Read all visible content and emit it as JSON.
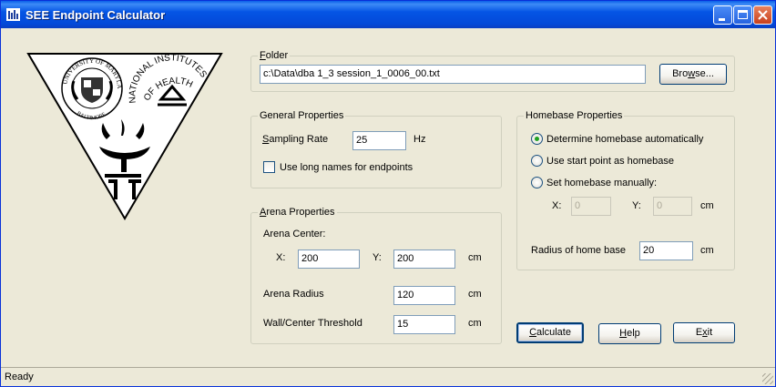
{
  "window": {
    "title": "SEE Endpoint Calculator"
  },
  "logo": {
    "university_text": "UNIVERSITY OF MARYLAND",
    "baltimore_text": "BALTIMORE",
    "nih_text": "NATIONAL INSTITUTES OF HEALTH",
    "nih_text_line1": "NATIONAL INSTITUTES",
    "nih_text_line2": "OF HEALTH"
  },
  "folder": {
    "legend_first": "F",
    "legend_rest": "older",
    "path_value": "c:\\Data\\dba 1_3 session_1_0006_00.txt",
    "browse_first": "Bro",
    "browse_u": "w",
    "browse_rest": "se..."
  },
  "general": {
    "legend": "General Properties",
    "sampling_first": "S",
    "sampling_rest": "ampling Rate",
    "sampling_value": "25",
    "sampling_unit": "Hz",
    "long_names_label": "Use long names for endpoints"
  },
  "arena": {
    "legend_first": "A",
    "legend_rest": "rena Properties",
    "center_label": "Arena Center:",
    "x_label": "X:",
    "x_value": "200",
    "y_label": "Y:",
    "y_value": "200",
    "center_unit": "cm",
    "radius_label": "Arena Radius",
    "radius_value": "120",
    "radius_unit": "cm",
    "threshold_label": "Wall/Center Threshold",
    "threshold_value": "15",
    "threshold_unit": "cm"
  },
  "homebase": {
    "legend": "Homebase Properties",
    "options": [
      {
        "label": "Determine homebase automatically",
        "selected": true
      },
      {
        "label": "Use start point as homebase",
        "selected": false
      },
      {
        "label": "Set homebase manually:",
        "selected": false
      }
    ],
    "x_label": "X:",
    "x_value": "0",
    "y_label": "Y:",
    "y_value": "0",
    "manual_unit": "cm",
    "radius_label": "Radius of home base",
    "radius_value": "20",
    "radius_unit": "cm"
  },
  "buttons": {
    "calculate_first": "C",
    "calculate_rest": "alculate",
    "help_first": "H",
    "help_rest": "elp",
    "exit_first": "E",
    "exit_u": "x",
    "exit_rest": "it"
  },
  "status": {
    "text": "Ready"
  },
  "colors": {
    "titlebar": "#0555e5",
    "face": "#ece9d8",
    "radio_dot": "#21a121"
  }
}
